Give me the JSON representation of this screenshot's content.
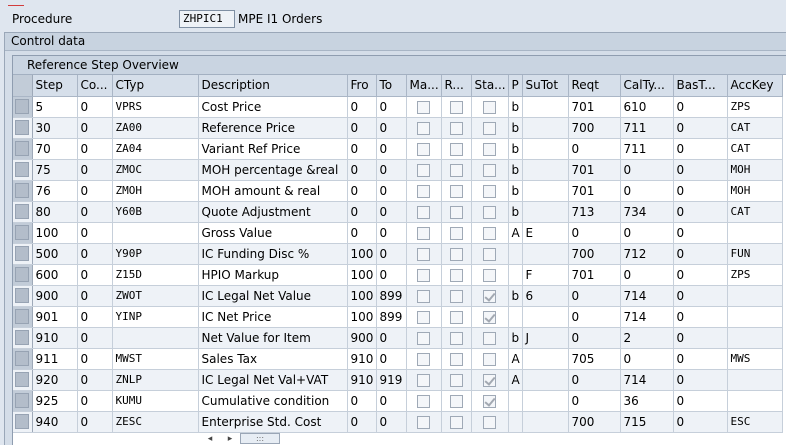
{
  "procedure": {
    "label": "Procedure",
    "code": "ZHPIC1",
    "description": "MPE I1  Orders"
  },
  "control_data": {
    "title": "Control data"
  },
  "overview": {
    "title": "Reference Step Overview",
    "columns": [
      "Step",
      "Co...",
      "CTyp",
      "Description",
      "Fro",
      "To",
      "Ma...",
      "R...",
      "Sta...",
      "P",
      "SuTot",
      "Reqt",
      "CalTy...",
      "BasT...",
      "AccKey"
    ],
    "rows": [
      {
        "step": "5",
        "co": "0",
        "ctyp": "VPRS",
        "desc": "Cost Price",
        "fro": "0",
        "to": "0",
        "ma": false,
        "r": false,
        "sta": false,
        "p": "b",
        "sutot": "",
        "reqt": "701",
        "calty": "610",
        "bast": "0",
        "acckey": "ZPS"
      },
      {
        "step": "30",
        "co": "0",
        "ctyp": "ZA00",
        "desc": "Reference Price",
        "fro": "0",
        "to": "0",
        "ma": false,
        "r": false,
        "sta": false,
        "p": "b",
        "sutot": "",
        "reqt": "700",
        "calty": "711",
        "bast": "0",
        "acckey": "CAT"
      },
      {
        "step": "70",
        "co": "0",
        "ctyp": "ZA04",
        "desc": "Variant Ref Price",
        "fro": "0",
        "to": "0",
        "ma": false,
        "r": false,
        "sta": false,
        "p": "b",
        "sutot": "",
        "reqt": "0",
        "calty": "711",
        "bast": "0",
        "acckey": "CAT"
      },
      {
        "step": "75",
        "co": "0",
        "ctyp": "ZMOC",
        "desc": "MOH percentage &real",
        "fro": "0",
        "to": "0",
        "ma": false,
        "r": false,
        "sta": false,
        "p": "b",
        "sutot": "",
        "reqt": "701",
        "calty": "0",
        "bast": "0",
        "acckey": "MOH"
      },
      {
        "step": "76",
        "co": "0",
        "ctyp": "ZMOH",
        "desc": "MOH amount & real",
        "fro": "0",
        "to": "0",
        "ma": false,
        "r": false,
        "sta": false,
        "p": "b",
        "sutot": "",
        "reqt": "701",
        "calty": "0",
        "bast": "0",
        "acckey": "MOH"
      },
      {
        "step": "80",
        "co": "0",
        "ctyp": "Y60B",
        "desc": "Quote Adjustment",
        "fro": "0",
        "to": "0",
        "ma": false,
        "r": false,
        "sta": false,
        "p": "b",
        "sutot": "",
        "reqt": "713",
        "calty": "734",
        "bast": "0",
        "acckey": "CAT"
      },
      {
        "step": "100",
        "co": "0",
        "ctyp": "",
        "desc": "Gross Value",
        "fro": "0",
        "to": "0",
        "ma": false,
        "r": false,
        "sta": false,
        "p": "A",
        "sutot": "E",
        "reqt": "0",
        "calty": "0",
        "bast": "0",
        "acckey": ""
      },
      {
        "step": "500",
        "co": "0",
        "ctyp": "Y90P",
        "desc": "IC Funding Disc  %",
        "fro": "100",
        "to": "0",
        "ma": false,
        "r": false,
        "sta": false,
        "p": "",
        "sutot": "",
        "reqt": "700",
        "calty": "712",
        "bast": "0",
        "acckey": "FUN"
      },
      {
        "step": "600",
        "co": "0",
        "ctyp": "Z15D",
        "desc": "HPIO Markup",
        "fro": "100",
        "to": "0",
        "ma": false,
        "r": false,
        "sta": false,
        "p": "",
        "sutot": "F",
        "reqt": "701",
        "calty": "0",
        "bast": "0",
        "acckey": "ZPS"
      },
      {
        "step": "900",
        "co": "0",
        "ctyp": "ZWOT",
        "desc": "IC Legal Net Value",
        "fro": "100",
        "to": "899",
        "ma": false,
        "r": false,
        "sta": true,
        "p": "b",
        "sutot": "6",
        "reqt": "0",
        "calty": "714",
        "bast": "0",
        "acckey": ""
      },
      {
        "step": "901",
        "co": "0",
        "ctyp": "YINP",
        "desc": "IC Net Price",
        "fro": "100",
        "to": "899",
        "ma": false,
        "r": false,
        "sta": true,
        "p": "",
        "sutot": "",
        "reqt": "0",
        "calty": "714",
        "bast": "0",
        "acckey": ""
      },
      {
        "step": "910",
        "co": "0",
        "ctyp": "",
        "desc": "Net Value for Item",
        "fro": "900",
        "to": "0",
        "ma": false,
        "r": false,
        "sta": false,
        "p": "b",
        "sutot": "J",
        "reqt": "0",
        "calty": "2",
        "bast": "0",
        "acckey": ""
      },
      {
        "step": "911",
        "co": "0",
        "ctyp": "MWST",
        "desc": "Sales Tax",
        "fro": "910",
        "to": "0",
        "ma": false,
        "r": false,
        "sta": false,
        "p": "A",
        "sutot": "",
        "reqt": "705",
        "calty": "0",
        "bast": "0",
        "acckey": "MWS"
      },
      {
        "step": "920",
        "co": "0",
        "ctyp": "ZNLP",
        "desc": "IC Legal Net Val+VAT",
        "fro": "910",
        "to": "919",
        "ma": false,
        "r": false,
        "sta": true,
        "p": "A",
        "sutot": "",
        "reqt": "0",
        "calty": "714",
        "bast": "0",
        "acckey": ""
      },
      {
        "step": "925",
        "co": "0",
        "ctyp": "KUMU",
        "desc": "Cumulative condition",
        "fro": "0",
        "to": "0",
        "ma": false,
        "r": false,
        "sta": true,
        "p": "",
        "sutot": "",
        "reqt": "0",
        "calty": "36",
        "bast": "0",
        "acckey": ""
      },
      {
        "step": "940",
        "co": "0",
        "ctyp": "ZESC",
        "desc": "Enterprise Std. Cost",
        "fro": "0",
        "to": "0",
        "ma": false,
        "r": false,
        "sta": false,
        "p": "",
        "sutot": "",
        "reqt": "700",
        "calty": "715",
        "bast": "0",
        "acckey": "ESC"
      }
    ]
  },
  "scrollbar": {
    "left_arrow": "◂",
    "right_arrow": "▸",
    "thumb": ":::"
  },
  "colors": {
    "background": "#dfe6ef",
    "header": "#d6dfea",
    "row_alt": "#eef2f7"
  }
}
